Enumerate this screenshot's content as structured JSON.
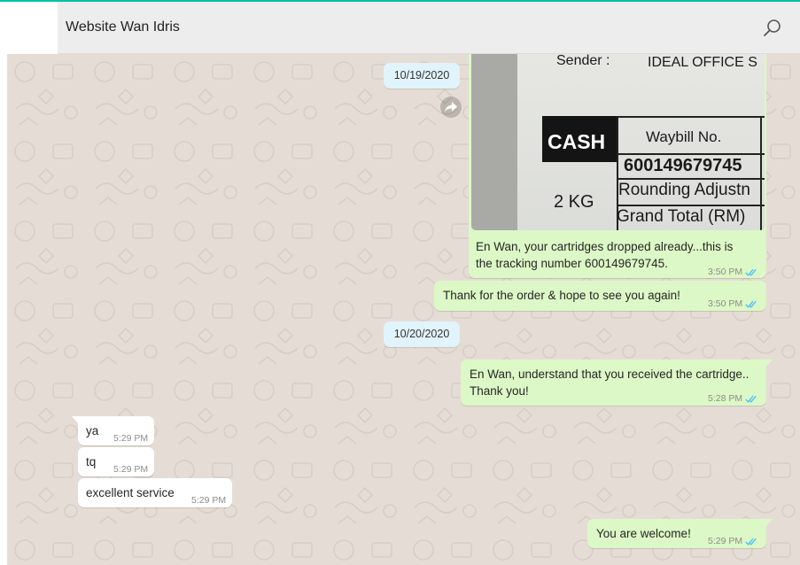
{
  "header": {
    "title": "Website Wan Idris",
    "search_icon": "search-icon"
  },
  "colors": {
    "accent": "#00bfa5",
    "chat_background": "#e5ddd5",
    "outgoing_bubble": "#dcf8c6",
    "incoming_bubble": "#ffffff",
    "date_chip": "#e1f3fb",
    "read_ticks": "#4fc3f7"
  },
  "chat": {
    "date_chips": [
      "10/19/2020",
      "10/20/2020"
    ],
    "forward_icon": "forward-icon",
    "image_message": {
      "receipt": {
        "sender_label": "Sender :",
        "sender_value": "IDEAL OFFICE S",
        "cash_label": "CASH",
        "waybill_label": "Waybill No.",
        "waybill_value": "600149679745",
        "weight": "2 KG",
        "rounding_label": "Rounding Adjustn",
        "grand_total_label": "Grand Total (RM)"
      },
      "caption_line1": "En Wan, your cartridges dropped already...this is",
      "caption_line2": "the tracking number 600149679745.",
      "time": "3:50 PM"
    },
    "messages": [
      {
        "direction": "out",
        "text": "Thank for the order & hope to see you again!",
        "time": "3:50 PM"
      },
      {
        "direction": "out",
        "line1": "En Wan, understand that you received the cartridge..",
        "line2": "Thank you!",
        "time": "5:28 PM"
      },
      {
        "direction": "in",
        "text": "ya",
        "time": "5:29 PM"
      },
      {
        "direction": "in",
        "text": "tq",
        "time": "5:29 PM"
      },
      {
        "direction": "in",
        "text": "excellent service",
        "time": "5:29 PM"
      },
      {
        "direction": "out",
        "text": "You are welcome!",
        "time": "5:29 PM"
      }
    ]
  }
}
